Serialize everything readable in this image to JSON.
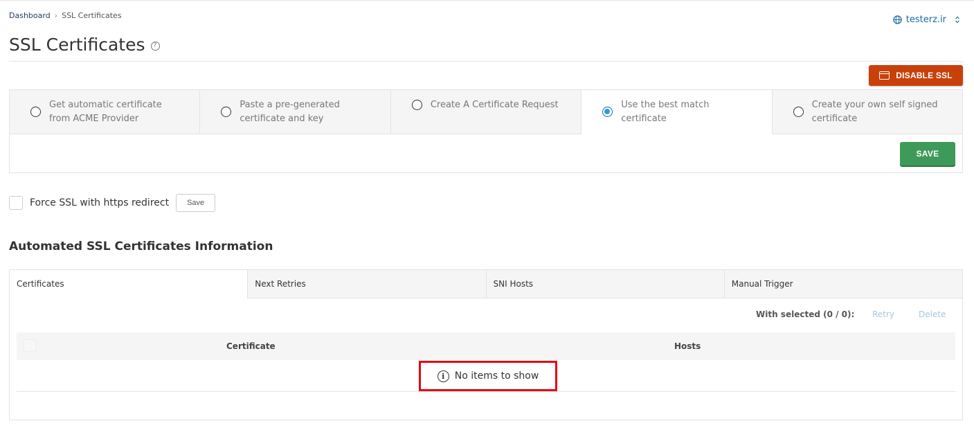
{
  "breadcrumb": {
    "home": "Dashboard",
    "separator": "›",
    "current": "SSL Certificates"
  },
  "domain_selector": {
    "label": "testerz.ir",
    "icon": "globe-icon"
  },
  "page": {
    "title": "SSL Certificates",
    "help_icon": "?"
  },
  "actions": {
    "disable_ssl": "DISABLE SSL",
    "save": "SAVE"
  },
  "ssl_options": [
    {
      "label": "Get automatic certificate from ACME Provider",
      "checked": false
    },
    {
      "label": "Paste a pre-generated certificate and key",
      "checked": false
    },
    {
      "label": "Create A Certificate Request",
      "checked": false
    },
    {
      "label": "Use the best match certificate",
      "checked": true
    },
    {
      "label": "Create your own self signed certificate",
      "checked": false
    }
  ],
  "force_ssl": {
    "label": "Force SSL with https redirect",
    "save": "Save",
    "checked": false
  },
  "automated": {
    "title": "Automated SSL Certificates Information",
    "tabs": [
      "Certificates",
      "Next Retries",
      "SNI Hosts",
      "Manual Trigger"
    ],
    "with_selected": "With selected (0 / 0):",
    "retry": "Retry",
    "delete": "Delete",
    "columns": [
      "Certificate",
      "Hosts"
    ],
    "empty_message": "No items to show",
    "empty_icon": "i"
  },
  "colors": {
    "accent": "#1b6aa0",
    "danger": "#c9400b",
    "success": "#3e9a58",
    "highlight": "#e30613"
  }
}
